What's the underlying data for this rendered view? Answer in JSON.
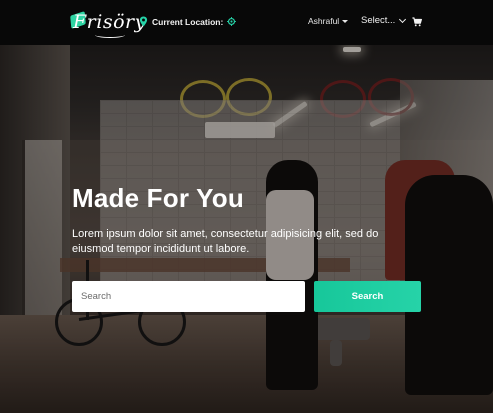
{
  "brand": {
    "logo_text": "Frisöry",
    "accent_color": "#26d3a8"
  },
  "navbar": {
    "location_label": "Current Location:",
    "location_icon": "map-pin-icon",
    "locate_icon": "crosshair-target-icon",
    "user_label": "Ashraful",
    "select_label": "Select...",
    "cart_icon": "shopping-cart-icon"
  },
  "hero": {
    "headline": "Made For You",
    "subtext": "Lorem ipsum dolor sit amet, consectetur adipisicing elit, sed do eiusmod tempor incididunt ut labore.",
    "search": {
      "placeholder": "Search",
      "value": "",
      "button_label": "Search"
    }
  }
}
